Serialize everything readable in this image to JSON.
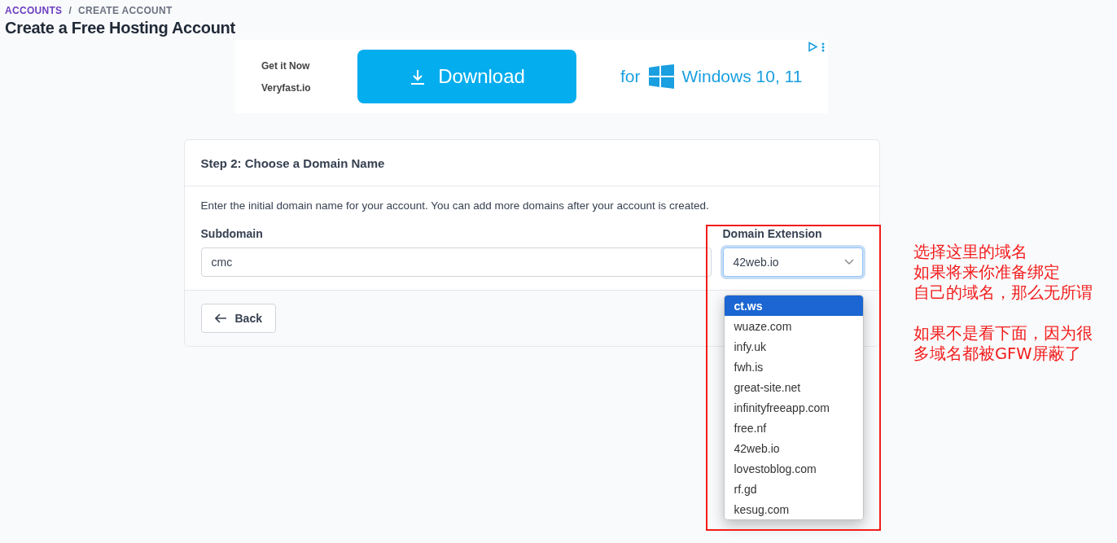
{
  "breadcrumb_separator": "/",
  "breadcrumb": [
    {
      "label": "ACCOUNTS",
      "kind": "link"
    },
    {
      "label": "CREATE ACCOUNT",
      "kind": "current"
    }
  ],
  "page_title": "Create a Free Hosting Account",
  "ad": {
    "lines": [
      "Get it Now",
      "Veryfast.io"
    ],
    "button": "Download",
    "for": "for",
    "product": "Windows 10, 11"
  },
  "card": {
    "title": "Step 2: Choose a Domain Name",
    "description": "Enter the initial domain name for your account. You can add more domains after your account is created.",
    "subdomain": {
      "label": "Subdomain",
      "value": "cmc"
    },
    "extension": {
      "label": "Domain Extension",
      "value": "42web.io",
      "expanded": true,
      "options": [
        {
          "label": "ct.ws",
          "highlighted": true
        },
        {
          "label": "wuaze.com",
          "highlighted": false
        },
        {
          "label": "infy.uk",
          "highlighted": false
        },
        {
          "label": "fwh.is",
          "highlighted": false
        },
        {
          "label": "great-site.net",
          "highlighted": false
        },
        {
          "label": "infinityfreeapp.com",
          "highlighted": false
        },
        {
          "label": "free.nf",
          "highlighted": false
        },
        {
          "label": "42web.io",
          "highlighted": false
        },
        {
          "label": "lovestoblog.com",
          "highlighted": false
        },
        {
          "label": "rf.gd",
          "highlighted": false
        },
        {
          "label": "kesug.com",
          "highlighted": false
        }
      ]
    },
    "back_button": "Back"
  },
  "annotation": {
    "paragraphs": [
      [
        "选择这里的域名",
        "如果将来你准备绑定",
        "自己的域名，那么无所谓"
      ],
      [
        "如果不是看下面，因为很",
        "多域名都被GFW屏蔽了"
      ]
    ]
  }
}
